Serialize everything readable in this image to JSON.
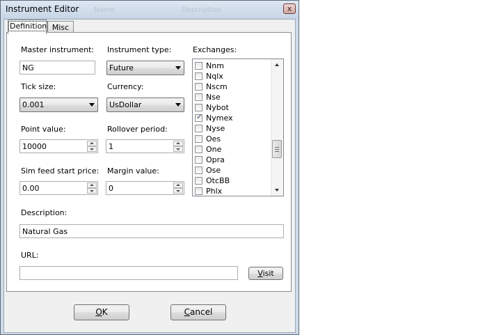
{
  "window": {
    "title": "Instrument Editor",
    "ghost_headers": [
      "Name",
      "Description"
    ],
    "close_glyph": "x"
  },
  "tabs": [
    {
      "label": "Definition",
      "active": true
    },
    {
      "label": "Misc",
      "active": false
    }
  ],
  "form": {
    "master_instrument": {
      "label": "Master instrument:",
      "value": "NG"
    },
    "instrument_type": {
      "label": "Instrument type:",
      "value": "Future"
    },
    "tick_size": {
      "label": "Tick size:",
      "value": "0.001"
    },
    "currency": {
      "label": "Currency:",
      "value": "UsDollar"
    },
    "point_value": {
      "label": "Point value:",
      "value": "10000"
    },
    "rollover_period": {
      "label": "Rollover period:",
      "value": "1"
    },
    "sim_feed_start_price": {
      "label": "Sim feed start price:",
      "value": "0.00"
    },
    "margin_value": {
      "label": "Margin value:",
      "value": "0"
    },
    "description": {
      "label": "Description:",
      "value": "Natural Gas"
    },
    "url": {
      "label": "URL:",
      "value": "",
      "visit_button": {
        "accel": "V",
        "rest": "isit"
      }
    }
  },
  "exchanges": {
    "label": "Exchanges:",
    "items": [
      {
        "name": "Nnm",
        "checked": false
      },
      {
        "name": "Nqlx",
        "checked": false
      },
      {
        "name": "Nscm",
        "checked": false
      },
      {
        "name": "Nse",
        "checked": false
      },
      {
        "name": "Nybot",
        "checked": false
      },
      {
        "name": "Nymex",
        "checked": true
      },
      {
        "name": "Nyse",
        "checked": false
      },
      {
        "name": "Oes",
        "checked": false
      },
      {
        "name": "One",
        "checked": false
      },
      {
        "name": "Opra",
        "checked": false
      },
      {
        "name": "Ose",
        "checked": false
      },
      {
        "name": "OtcBB",
        "checked": false
      },
      {
        "name": "Phlx",
        "checked": false
      }
    ],
    "check_glyph": "✓"
  },
  "buttons": {
    "ok": {
      "accel": "O",
      "rest": "K"
    },
    "cancel": {
      "accel": "C",
      "rest": "ancel"
    }
  }
}
